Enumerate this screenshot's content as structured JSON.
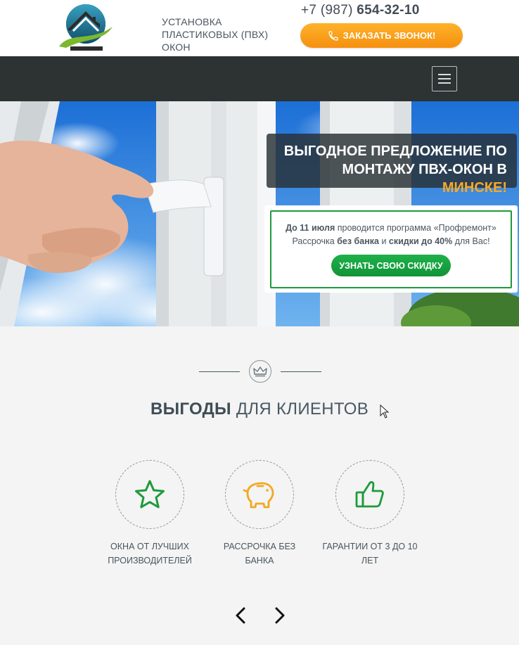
{
  "header": {
    "tagline": "УСТАНОВКА ПЛАСТИКОВЫХ (ПВХ) ОКОН",
    "phone_prefix": "+7 (987)",
    "phone_number": "654-32-10",
    "call_button_label": "ЗАКАЗАТЬ ЗВОНОК!",
    "logo_icon": "house-logo-icon"
  },
  "nav": {
    "menu_icon": "hamburger-menu-icon"
  },
  "hero": {
    "title_line": "ВЫГОДНОЕ ПРЕДЛОЖЕНИЕ ПО МОНТАЖУ ПВХ-ОКОН В",
    "title_city": "МИНСКЕ!",
    "offer": {
      "l1_bold": "До 11 июля",
      "l1_rest": "проводится программа «Профремонт»",
      "l2_a": "Рассрочка",
      "l2_bold1": "без банка",
      "l2_b": "и",
      "l2_bold2": "скидки до 40%",
      "l2_c": "для Вас!",
      "button_label": "УЗНАТЬ СВОЮ СКИДКУ"
    }
  },
  "benefits": {
    "title_bold": "ВЫГОДЫ",
    "title_rest": "ДЛЯ КЛИЕНТОВ",
    "items": [
      {
        "label": "ОКНА ОТ ЛУЧШИХ ПРОИЗВОДИТЕЛЕЙ",
        "icon": "star-icon"
      },
      {
        "label": "РАССРОЧКА БЕЗ БАНКА",
        "icon": "piggy-bank-icon"
      },
      {
        "label": "ГАРАНТИИ ОТ 3 ДО 10 ЛЕТ",
        "icon": "thumbs-up-icon"
      }
    ]
  },
  "colors": {
    "accent_orange": "#f7a825",
    "accent_green": "#1d9a3c",
    "nav_dark": "#2d3233"
  }
}
